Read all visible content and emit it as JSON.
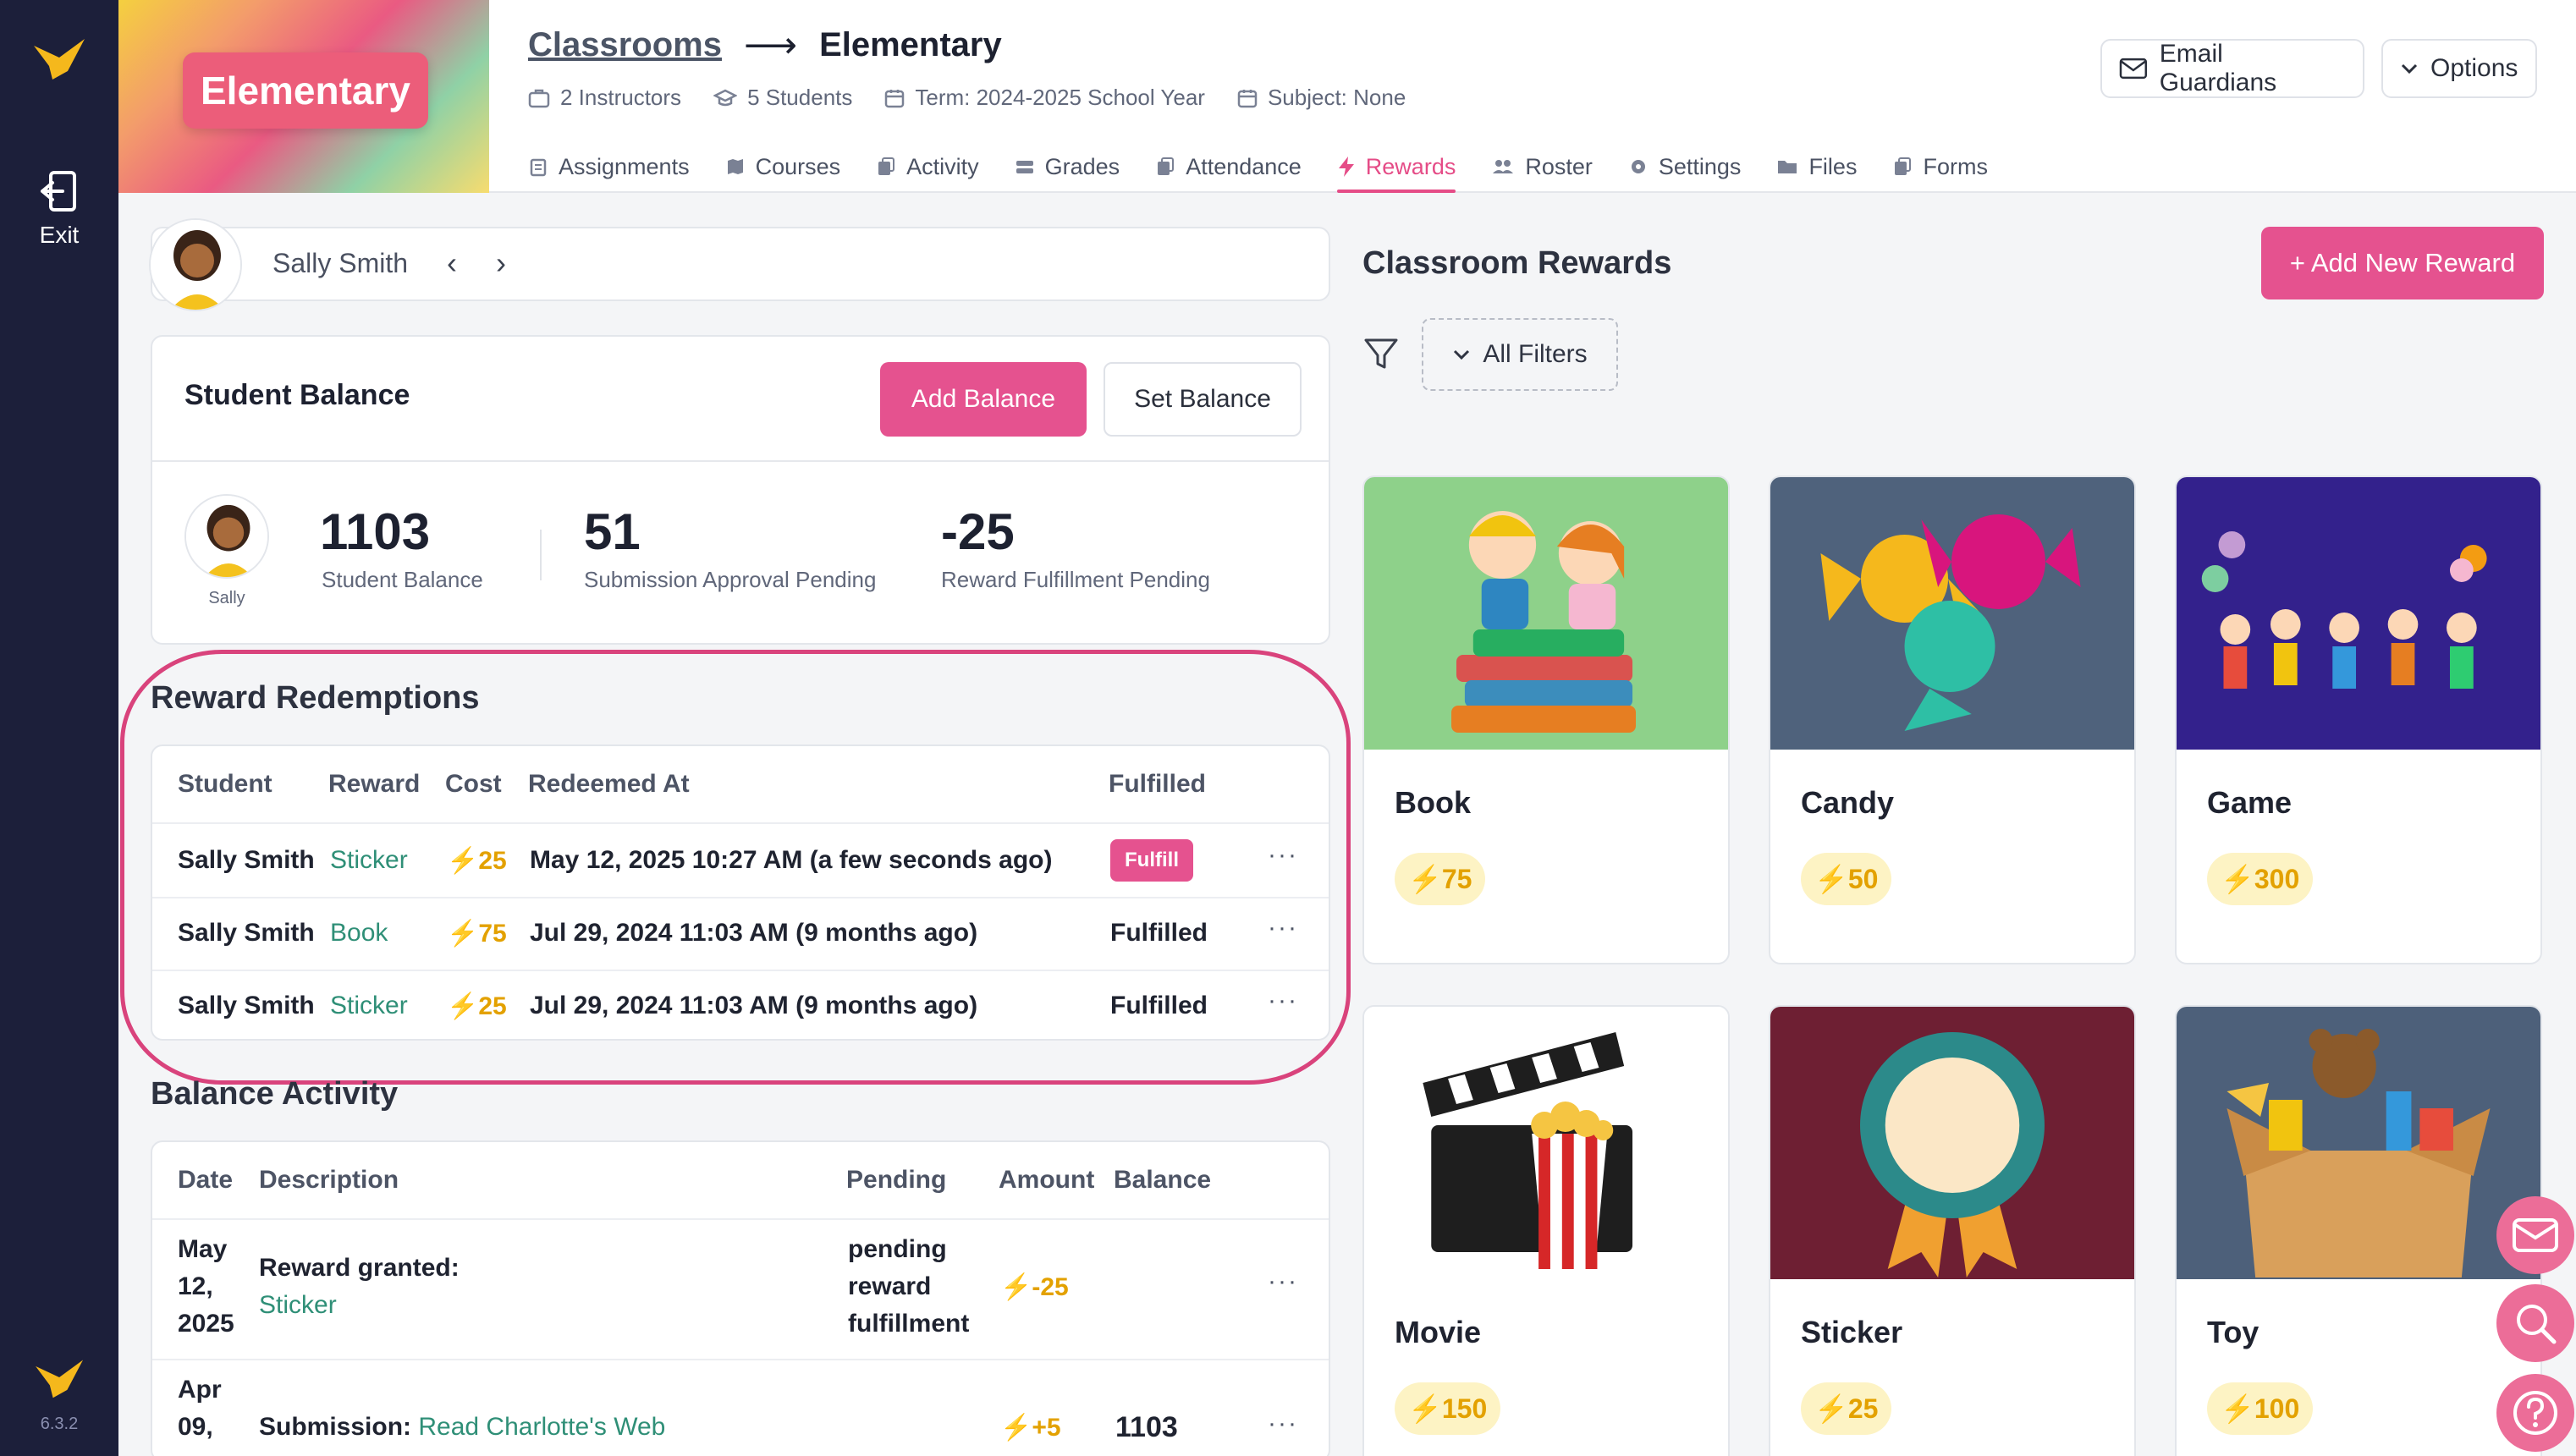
{
  "header": {
    "banner_label": "Elementary",
    "breadcrumb": {
      "parent": "Classrooms",
      "current": "Elementary"
    },
    "meta": {
      "instructors": "2 Instructors",
      "students": "5 Students",
      "term": "Term: 2024-2025 School Year",
      "subject": "Subject: None"
    },
    "tabs": [
      {
        "label": "Assignments",
        "icon": "clipboard-icon"
      },
      {
        "label": "Courses",
        "icon": "map-icon"
      },
      {
        "label": "Activity",
        "icon": "activity-icon"
      },
      {
        "label": "Grades",
        "icon": "grades-icon"
      },
      {
        "label": "Attendance",
        "icon": "attendance-icon"
      },
      {
        "label": "Rewards",
        "icon": "bolt-icon",
        "active": true
      },
      {
        "label": "Roster",
        "icon": "people-icon"
      },
      {
        "label": "Settings",
        "icon": "gear-icon"
      },
      {
        "label": "Files",
        "icon": "folder-icon"
      },
      {
        "label": "Forms",
        "icon": "forms-icon"
      }
    ],
    "email_guardians": "Email Guardians",
    "options": "Options"
  },
  "rail": {
    "exit": "Exit",
    "version": "6.3.2"
  },
  "student": {
    "name": "Sally Smith",
    "short_name": "Sally"
  },
  "balance": {
    "title": "Student Balance",
    "add_balance": "Add Balance",
    "set_balance": "Set Balance",
    "balance_value": "1103",
    "balance_label": "Student Balance",
    "submission_value": "51",
    "submission_label": "Submission Approval Pending",
    "reward_value": "-25",
    "reward_label": "Reward Fulfillment Pending"
  },
  "redemptions": {
    "title": "Reward Redemptions",
    "columns": [
      "Student",
      "Reward",
      "Cost",
      "Redeemed At",
      "Fulfilled"
    ],
    "rows": [
      {
        "student": "Sally Smith",
        "reward": "Sticker",
        "cost": "⚡25",
        "redeemed_at": "May 12, 2025 10:27 AM (a few seconds ago)",
        "fulfilled": "Fulfill"
      },
      {
        "student": "Sally Smith",
        "reward": "Book",
        "cost": "⚡75",
        "redeemed_at": "Jul 29, 2024 11:03 AM (9 months ago)",
        "fulfilled": "Fulfilled"
      },
      {
        "student": "Sally Smith",
        "reward": "Sticker",
        "cost": "⚡25",
        "redeemed_at": "Jul 29, 2024 11:03 AM (9 months ago)",
        "fulfilled": "Fulfilled"
      }
    ]
  },
  "activity": {
    "title": "Balance Activity",
    "columns": [
      "Date",
      "Description",
      "Pending",
      "Amount",
      "Balance"
    ],
    "rows": [
      {
        "date_l1": "May",
        "date_l2": "12,",
        "date_l3": "2025",
        "desc_prefix": "Reward granted:",
        "desc_link": "Sticker",
        "pending_l1": "pending",
        "pending_l2": "reward",
        "pending_l3": "fulfillment",
        "amount": "⚡-25",
        "balance": ""
      },
      {
        "date_l1": "Apr",
        "date_l2": "09,",
        "desc_prefix": "Submission:",
        "desc_link": "Read Charlotte's Web",
        "amount": "⚡+5",
        "balance": "1103"
      }
    ]
  },
  "rewards": {
    "title": "Classroom Rewards",
    "add_button": "+ Add New Reward",
    "filters": "All Filters",
    "items": [
      {
        "name": "Book",
        "cost": "⚡75",
        "bg": "#8ed18a"
      },
      {
        "name": "Candy",
        "cost": "⚡50",
        "bg": "#4f627c"
      },
      {
        "name": "Game",
        "cost": "⚡300",
        "bg": "#33218c"
      },
      {
        "name": "Movie",
        "cost": "⚡150",
        "bg": "#ffffff"
      },
      {
        "name": "Sticker",
        "cost": "⚡25",
        "bg": "#6e1f33"
      },
      {
        "name": "Toy",
        "cost": "⚡100",
        "bg": "#4d607a"
      }
    ]
  },
  "icons": {
    "more": "···",
    "bolt": "⚡"
  },
  "colors": {
    "accent": "#e5528f",
    "rail": "#1c1f3a",
    "link": "#2f8f77",
    "points": "#e3a100"
  }
}
